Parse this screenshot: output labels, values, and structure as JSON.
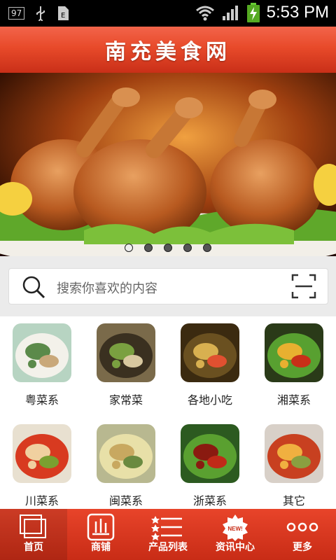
{
  "status_bar": {
    "badge": "97",
    "time": "5:53 PM"
  },
  "header": {
    "title": "南充美食网"
  },
  "banner": {
    "slide_count": 5,
    "active_slide": 1
  },
  "search": {
    "placeholder": "搜索你喜欢的内容"
  },
  "categories": [
    {
      "label": "粤菜系",
      "icon": "cantonese-dish-image"
    },
    {
      "label": "家常菜",
      "icon": "home-dish-image"
    },
    {
      "label": "各地小吃",
      "icon": "snack-image"
    },
    {
      "label": "湘菜系",
      "icon": "hunan-dish-image"
    },
    {
      "label": "川菜系",
      "icon": "sichuan-dish-image"
    },
    {
      "label": "闽菜系",
      "icon": "fujian-dish-image"
    },
    {
      "label": "浙菜系",
      "icon": "zhejiang-dish-image"
    },
    {
      "label": "其它",
      "icon": "other-dish-image"
    }
  ],
  "tabs": [
    {
      "label": "首页",
      "icon": "home-icon"
    },
    {
      "label": "商铺",
      "icon": "shop-icon"
    },
    {
      "label": "产品列表",
      "icon": "list-icon"
    },
    {
      "label": "资讯中心",
      "icon": "news-icon"
    },
    {
      "label": "更多",
      "icon": "more-icon"
    }
  ],
  "colors": {
    "brand_red": "#e84a2a",
    "tab_red": "#c82c16"
  }
}
